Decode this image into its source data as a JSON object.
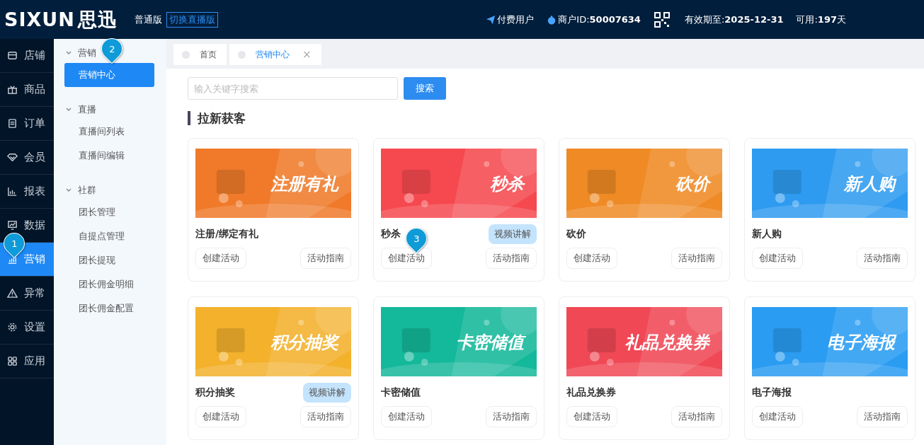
{
  "header": {
    "logo_latin": "SIXUN",
    "logo_cn": "思迅",
    "edition": "普通版",
    "switch_link": "切换直播版",
    "user_type": "付费用户",
    "merchant_label": "商户ID:",
    "merchant_id": "50007634",
    "expiry_label": "有效期至:",
    "expiry": "2025-12-31",
    "remaining_label": "可用:",
    "remaining": "197",
    "remaining_unit": "天"
  },
  "nav": [
    {
      "label": "店铺",
      "selected": false
    },
    {
      "label": "商品",
      "selected": false
    },
    {
      "label": "订单",
      "selected": false
    },
    {
      "label": "会员",
      "selected": false
    },
    {
      "label": "报表",
      "selected": false
    },
    {
      "label": "数据",
      "selected": false
    },
    {
      "label": "营销",
      "selected": true
    },
    {
      "label": "异常",
      "selected": false
    },
    {
      "label": "设置",
      "selected": false
    },
    {
      "label": "应用",
      "selected": false
    }
  ],
  "subnav": [
    {
      "label": "营销",
      "expanded": true,
      "children": [
        {
          "label": "营销中心",
          "selected": true
        }
      ]
    },
    {
      "label": "直播",
      "expanded": true,
      "children": [
        {
          "label": "直播间列表",
          "selected": false
        },
        {
          "label": "直播间编辑",
          "selected": false
        }
      ]
    },
    {
      "label": "社群",
      "expanded": true,
      "children": [
        {
          "label": "团长管理",
          "selected": false
        },
        {
          "label": "自提点管理",
          "selected": false
        },
        {
          "label": "团长提现",
          "selected": false
        },
        {
          "label": "团长佣金明细",
          "selected": false
        },
        {
          "label": "团长佣金配置",
          "selected": false
        }
      ]
    }
  ],
  "tabs": [
    {
      "label": "首页",
      "selected": false,
      "closable": false
    },
    {
      "label": "营销中心",
      "selected": true,
      "closable": true,
      "close": "×"
    }
  ],
  "search": {
    "placeholder": "输入关键字搜索",
    "button": "搜索"
  },
  "section_title": "拉新获客",
  "cards": [
    {
      "title": "注册/绑定有礼",
      "banner": "注册有礼",
      "color": "#f07a2a",
      "create": "创建活动",
      "guide": "活动指南"
    },
    {
      "title": "秒杀",
      "banner": "秒杀",
      "color": "#f5494f",
      "video": "视频讲解",
      "create": "创建活动",
      "guide": "活动指南"
    },
    {
      "title": "砍价",
      "banner": "砍价",
      "color": "#ef8a25",
      "create": "创建活动",
      "guide": "活动指南"
    },
    {
      "title": "新人购",
      "banner": "新人购",
      "color": "#2e9bf0",
      "create": "创建活动",
      "guide": "活动指南"
    },
    {
      "title": "积分抽奖",
      "banner": "积分抽奖",
      "color": "#f3b12c",
      "video": "视频讲解",
      "create": "创建活动",
      "guide": "活动指南"
    },
    {
      "title": "卡密储值",
      "banner": "卡密储值",
      "color": "#14b89a",
      "create": "创建活动",
      "guide": "活动指南"
    },
    {
      "title": "礼品兑换券",
      "banner": "礼品兑换券",
      "color": "#f04855",
      "create": "创建活动",
      "guide": "活动指南"
    },
    {
      "title": "电子海报",
      "banner": "电子海报",
      "color": "#2a9cf2",
      "create": "创建活动",
      "guide": "活动指南"
    }
  ],
  "markers": [
    {
      "label": "1"
    },
    {
      "label": "2"
    },
    {
      "label": "3"
    }
  ]
}
